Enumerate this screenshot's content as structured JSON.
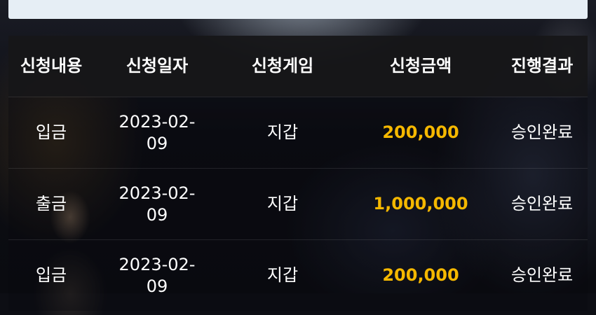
{
  "table": {
    "headers": [
      "신청내용",
      "신청일자",
      "신청게임",
      "신청금액",
      "진행결과"
    ],
    "rows": [
      {
        "type": "입금",
        "date": "2023-02-09",
        "game": "지갑",
        "amount": "200,000",
        "result": "승인완료"
      },
      {
        "type": "출금",
        "date": "2023-02-09",
        "game": "지갑",
        "amount": "1,000,000",
        "result": "승인완료"
      },
      {
        "type": "입금",
        "date": "2023-02-09",
        "game": "지갑",
        "amount": "200,000",
        "result": "승인완료"
      }
    ]
  },
  "colors": {
    "amount": "#f5b800",
    "header_bg": "#161618",
    "top_panel": "#e6eef5"
  }
}
